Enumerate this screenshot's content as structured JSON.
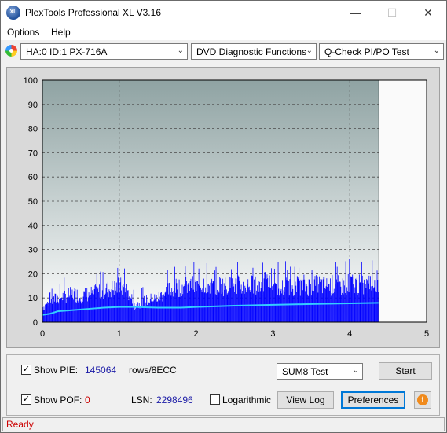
{
  "window": {
    "title": "PlexTools Professional XL V3.16",
    "app_icon_text": "XL",
    "minimize": "—",
    "maximize": "☐",
    "close": "✕"
  },
  "menu": {
    "options": "Options",
    "help": "Help"
  },
  "toolbar": {
    "drive": "HA:0 ID:1  PX-716A",
    "function": "DVD Diagnostic Functions",
    "test": "Q-Check PI/PO Test",
    "dropdown_arrow": "⌄"
  },
  "chart_data": {
    "type": "bar",
    "x_ticks": [
      "0",
      "1",
      "2",
      "3",
      "4",
      "5"
    ],
    "y_ticks": [
      "0",
      "10",
      "20",
      "30",
      "40",
      "50",
      "60",
      "70",
      "80",
      "90",
      "100"
    ],
    "xlim": [
      0,
      5
    ],
    "ylim": [
      0,
      100
    ],
    "grid": true,
    "data_end_x": 4.38,
    "pie_color": "#0000ff",
    "sum8_line_color": "#33ccff",
    "background_top_color": "#8fa3a3",
    "background_bottom_color": "#ffffff",
    "series": [
      {
        "x": [
          0.0,
          0.1,
          0.2,
          0.3,
          0.4,
          0.5,
          0.6,
          0.7,
          0.8,
          0.9,
          1.0,
          1.1,
          1.2,
          1.3,
          1.4,
          1.5,
          1.6,
          1.7,
          1.8,
          1.9,
          2.0,
          2.1,
          2.2,
          2.3,
          2.4,
          2.5,
          2.6,
          2.7,
          2.8,
          2.9,
          3.0,
          3.1,
          3.2,
          3.3,
          3.4,
          3.5,
          3.6,
          3.7,
          3.8,
          3.9,
          4.0,
          4.1,
          4.2,
          4.3,
          4.38
        ],
        "values": [
          8,
          11,
          13,
          14,
          15,
          14,
          15,
          16,
          17,
          18,
          19,
          17,
          9,
          11,
          12,
          13,
          16,
          18,
          19,
          20,
          19,
          21,
          19,
          20,
          19,
          20,
          19,
          20,
          19,
          21,
          20,
          18,
          20,
          19,
          20,
          19,
          20,
          19,
          20,
          19,
          21,
          20,
          19,
          21,
          22
        ]
      },
      {
        "x": [
          0.0,
          0.1,
          0.2,
          0.4,
          0.6,
          0.8,
          1.0,
          1.2,
          1.5,
          1.8,
          2.0,
          2.5,
          3.0,
          3.5,
          4.0,
          4.38
        ],
        "values": [
          3,
          3.5,
          4.5,
          5,
          5.5,
          6,
          6.3,
          6.3,
          6,
          6,
          6.3,
          6.8,
          7.2,
          7.5,
          7.8,
          8
        ]
      }
    ]
  },
  "controls": {
    "show_pie_label": "Show PIE:",
    "pie_value": "145064",
    "pie_unit": "rows/8ECC",
    "show_pof_label": "Show POF:",
    "pof_value": "0",
    "lsn_label": "LSN:",
    "lsn_value": "2298496",
    "logarithmic_label": "Logarithmic",
    "sum_test": "SUM8 Test",
    "start_button": "Start",
    "view_log_button": "View Log",
    "preferences_button": "Preferences",
    "info_icon": "i",
    "check_mark": "✓"
  },
  "status": {
    "text": "Ready"
  }
}
